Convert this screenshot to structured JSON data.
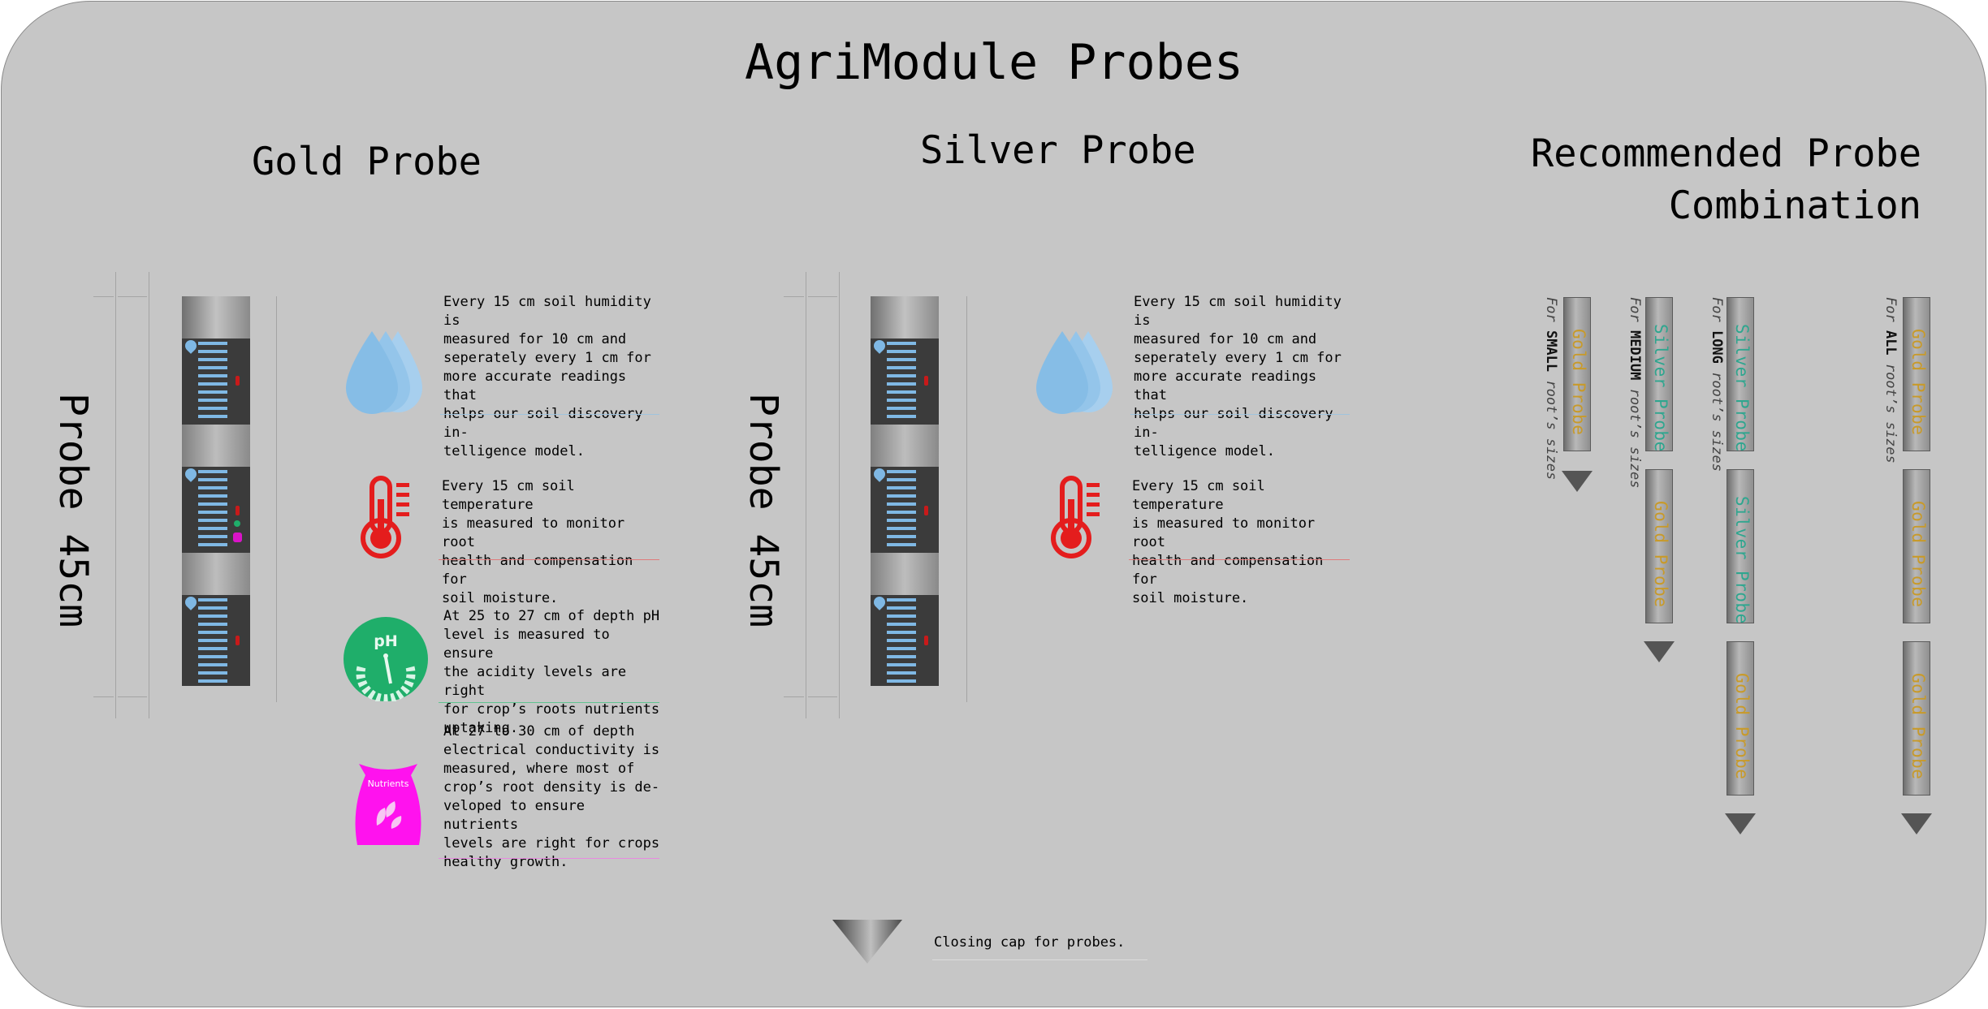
{
  "page": {
    "title": "AgriModule Probes"
  },
  "gold": {
    "title": "Gold Probe",
    "length_label": "Probe 45cm",
    "features": [
      {
        "icon": "water-drops-icon",
        "color": "#86bde6",
        "text": "Every 15 cm soil humidity is\nmeasured for 10 cm and\nseperately every 1 cm for\nmore accurate readings that\nhelps our soil discovery in-\ntelligence model."
      },
      {
        "icon": "thermometer-icon",
        "color": "#e41d1d",
        "text": "Every 15 cm soil temperature\nis measured to monitor root\nhealth and compensation for\nsoil moisture."
      },
      {
        "icon": "ph-meter-icon",
        "color": "#1fae6a",
        "icon_text": "pH",
        "text": "At  25 to 27 cm of depth pH\nlevel is measured to ensure\nthe acidity levels are right\nfor crop’s roots nutrients\nuptaking."
      },
      {
        "icon": "nutrients-bag-icon",
        "color": "#ff12ee",
        "icon_text": "Nutrients",
        "text": "At 27 to 30 cm of depth\nelectrical conductivity is\nmeasured, where most of\ncrop’s root density is de-\nveloped to ensure nutrients\nlevels are right for crops\nhealthy growth."
      }
    ]
  },
  "silver": {
    "title": "Silver Probe",
    "length_label": "Probe 45cm",
    "features": [
      {
        "icon": "water-drops-icon",
        "color": "#86bde6",
        "text": "Every 15 cm soil humidity is\nmeasured for 10 cm and\nseperately every 1 cm for\nmore accurate readings that\nhelps our soil discovery in-\ntelligence model."
      },
      {
        "icon": "thermometer-icon",
        "color": "#e41d1d",
        "text": "Every 15 cm soil temperature\nis measured to monitor root\nhealth and compensation for\nsoil moisture."
      }
    ]
  },
  "recommended": {
    "title_line1": "Recommended Probe",
    "title_line2": "Combination",
    "gold_label": "Gold Probe",
    "silver_label": "Silver Probe",
    "gold_color": "#c89a2a",
    "silver_color": "#2fa68f",
    "combos": [
      {
        "prefix": "For ",
        "size": "SMALL",
        "suffix": " root’s sizes",
        "probes": [
          "gold"
        ]
      },
      {
        "prefix": "For ",
        "size": "MEDIUM",
        "suffix": " root’s sizes",
        "probes": [
          "silver",
          "gold"
        ]
      },
      {
        "prefix": "For ",
        "size": "LONG",
        "suffix": " root’s sizes",
        "probes": [
          "silver",
          "silver",
          "gold"
        ]
      },
      {
        "prefix": "For ",
        "size": "ALL",
        "suffix": " root’s sizes",
        "probes": [
          "gold",
          "gold",
          "gold"
        ]
      }
    ]
  },
  "cap": {
    "text": "Closing cap for probes."
  }
}
